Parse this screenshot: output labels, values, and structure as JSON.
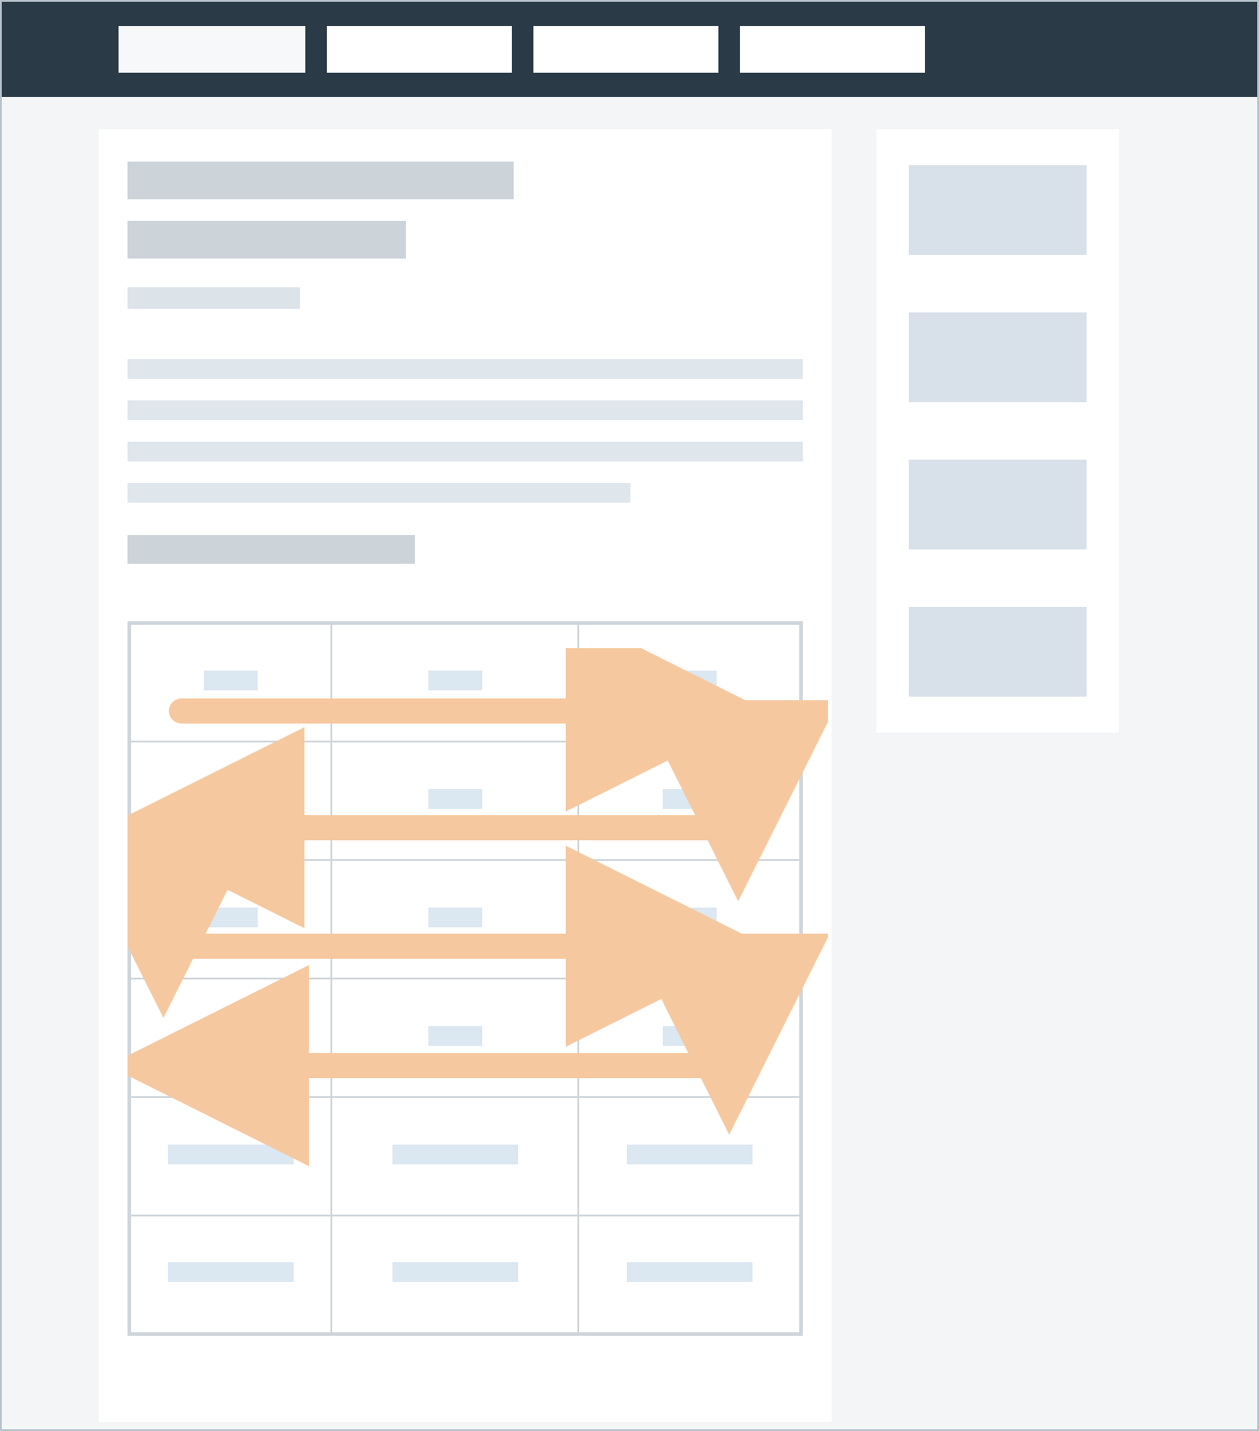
{
  "nav": {
    "tabs": [
      {
        "label": "",
        "active": true
      },
      {
        "label": "",
        "active": false
      },
      {
        "label": "",
        "active": false
      },
      {
        "label": "",
        "active": false
      }
    ]
  },
  "article": {
    "title": "",
    "subtitle": "",
    "meta": "",
    "paragraphs": [
      "",
      "",
      "",
      ""
    ],
    "section_heading": ""
  },
  "table": {
    "rows": 6,
    "cols": 3,
    "cells": [
      [
        "",
        "",
        ""
      ],
      [
        "",
        "",
        ""
      ],
      [
        "",
        "",
        ""
      ],
      [
        "",
        "",
        ""
      ],
      [
        "",
        "",
        ""
      ],
      [
        "",
        "",
        ""
      ]
    ],
    "linearization_pattern": "boustrophedon",
    "linearization_description": "Reading order zig-zags: row 1 left→right, down to row 2, row 2 right→left, down to row 3, row 3 left→right, down to row 4, row 4 right→left"
  },
  "sidebar": {
    "widgets": [
      "",
      "",
      "",
      ""
    ]
  },
  "colors": {
    "topbar": "#2a3b47",
    "page_bg": "#f4f5f6",
    "placeholder_dark": "#ccd3d9",
    "placeholder_light": "#dfe6ec",
    "cell_placeholder": "#dbe7f1",
    "arrow": "#f6c89f"
  }
}
